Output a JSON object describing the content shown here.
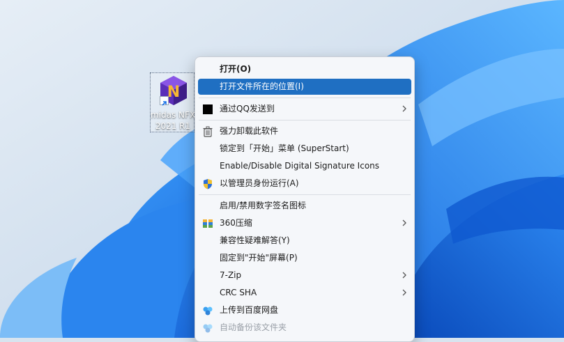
{
  "desktop": {
    "shortcut": {
      "label_line1": "midas NFX",
      "label_line2": "2021 R1",
      "icon": "midas-nfx-app-icon"
    }
  },
  "context_menu": {
    "items": [
      {
        "label": "打开(O)",
        "bold": true
      },
      {
        "label": "打开文件所在的位置(I)",
        "highlighted": true
      },
      {
        "label": "通过QQ发送到",
        "icon": "qq-send-icon",
        "submenu": true
      },
      {
        "label": "强力卸载此软件",
        "icon": "trash-icon"
      },
      {
        "label": "锁定到「开始」菜单 (SuperStart)"
      },
      {
        "label": "Enable/Disable Digital Signature Icons"
      },
      {
        "label": "以管理员身份运行(A)",
        "icon": "uac-shield-icon"
      },
      {
        "label": "启用/禁用数字签名图标"
      },
      {
        "label": "360压缩",
        "icon": "archive-360-icon",
        "submenu": true
      },
      {
        "label": "兼容性疑难解答(Y)"
      },
      {
        "label": "固定到\"开始\"屏幕(P)"
      },
      {
        "label": "7-Zip",
        "submenu": true
      },
      {
        "label": "CRC SHA",
        "submenu": true
      },
      {
        "label": "上传到百度网盘",
        "icon": "baidu-netdisk-icon"
      },
      {
        "label": "自动备份该文件夹",
        "icon": "baidu-netdisk-icon",
        "disabled": true
      }
    ]
  },
  "colors": {
    "highlight": "#1f6fc2",
    "wallpaper_blue": "#1466e0",
    "wallpaper_bg": "#d8e4ef"
  }
}
